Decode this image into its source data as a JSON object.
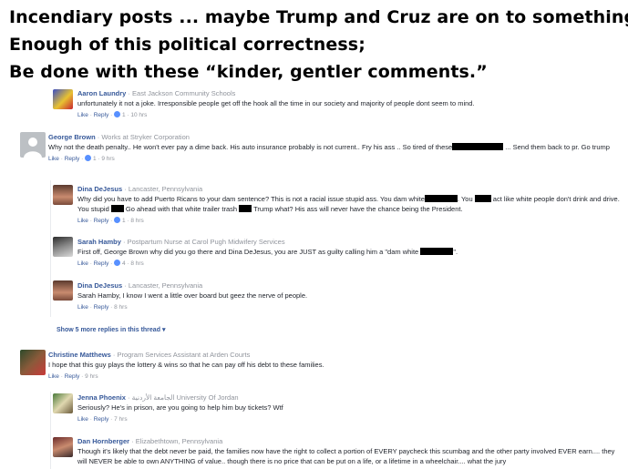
{
  "headline": [
    "Incendiary posts ... maybe Trump and Cruz are on to something.",
    "Enough of this political correctness;",
    "Be done with these “kinder, gentler comments.”"
  ],
  "separator": " · ",
  "like_label": "Like",
  "reply_label": "Reply",
  "comments": [
    {
      "name": "Aaron Laundry",
      "meta": "East Jackson Community Schools",
      "text": "unfortunately it not a joke. Irresponsible people get off the hook all the time in our society and majority of people dont seem to mind.",
      "likes": "1",
      "time": "10 hrs"
    },
    {
      "name": "George Brown",
      "meta": "Works at Stryker Corporation",
      "text_parts": [
        "Why not the death penalty.. He won't ever pay a dime back. His auto insurance probably is not current.. Fry his ass .. So tired of these",
        " ... Send them back to pr. Go trump"
      ],
      "likes": "1",
      "time": "9 hrs"
    },
    {
      "name": "Dina DeJesus",
      "meta": "Lancaster, Pennsylvania",
      "text_parts": [
        "Why did you have to add Puerto Ricans to your dam sentence? This is not a racial issue stupid ass. You dam white",
        ". You ",
        " act like white people don't drink and drive. You stupid ",
        " Go ahead with that white trailer trash ",
        " Trump what? His ass will never have the chance being the President."
      ],
      "likes": "1",
      "time": "8 hrs"
    },
    {
      "name": "Sarah Hamby",
      "meta": "Postpartum Nurse at Carol Pugh Midwifery Services",
      "text_parts": [
        "First off, George Brown why did you go there and Dina DeJesus, you are JUST as guilty calling him a \"dam white ",
        "\"."
      ],
      "likes": "4",
      "time": "8 hrs"
    },
    {
      "name": "Dina DeJesus",
      "meta": "Lancaster, Pennsylvania",
      "text": "Sarah Hamby, I know I went a little over board but geez the nerve of people.",
      "time": "8 hrs"
    },
    {
      "name": "Christine Matthews",
      "meta": "Program Services Assistant at Arden Courts",
      "text": "I hope that this guy plays the lottery & wins so that he can pay off his debt to these families.",
      "time": "9 hrs"
    },
    {
      "name": "Jenna Phoenix",
      "meta": "الجامعة الأردنية University Of Jordan",
      "text": "Seriously? He's in prison, are you going to help him buy tickets? Wtf",
      "time": "7 hrs"
    },
    {
      "name": "Dan Hornberger",
      "meta": "Elizabethtown, Pennsylvania",
      "text": "Though it's likely that the debt never be paid, the families now have the right to collect a portion of EVERY paycheck this scumbag and the other party involved EVER earn.... they will NEVER be able to own ANYTHING of value.. though there is no price that can be put on a life, or a lifetime in a wheelchair.... what the jury"
    }
  ],
  "more_replies": "Show 5 more replies in this thread",
  "more_caret": "▾",
  "colors": {
    "link": "#365899",
    "meta": "#90949c",
    "like_icon": "#5890ff"
  }
}
